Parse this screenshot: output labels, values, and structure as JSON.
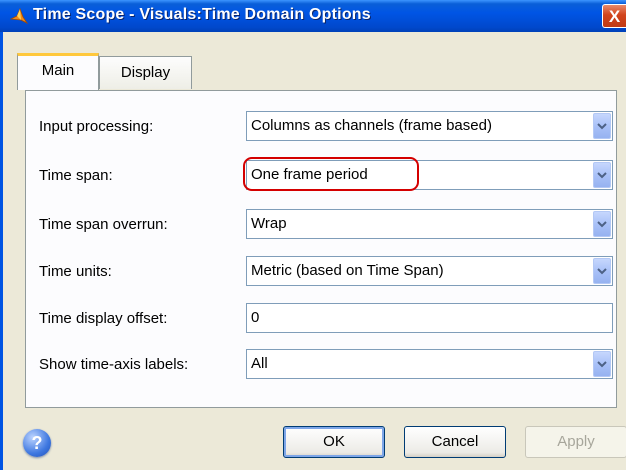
{
  "window": {
    "title": "Time Scope - Visuals:Time Domain Options",
    "close_glyph": "X",
    "title_icon": "matlab-logo-icon"
  },
  "tabs": [
    {
      "label": "Main",
      "active": true
    },
    {
      "label": "Display",
      "active": false
    }
  ],
  "fields": {
    "input_processing": {
      "label": "Input processing:",
      "value": "Columns as channels (frame based)"
    },
    "time_span": {
      "label": "Time span:",
      "value": "One frame period"
    },
    "time_span_overrun": {
      "label": "Time span overrun:",
      "value": "Wrap"
    },
    "time_units": {
      "label": "Time units:",
      "value": "Metric (based on Time Span)"
    },
    "time_display_offset": {
      "label": "Time display offset:",
      "value": "0"
    },
    "show_time_axis_labels": {
      "label": "Show time-axis labels:",
      "value": "All"
    }
  },
  "buttons": {
    "help_glyph": "?",
    "ok": "OK",
    "cancel": "Cancel",
    "apply": "Apply",
    "apply_enabled": false
  },
  "colors": {
    "titlebar": "#0055e5",
    "highlight": "#d40000",
    "active_tab_accent": "#ffc83c"
  }
}
